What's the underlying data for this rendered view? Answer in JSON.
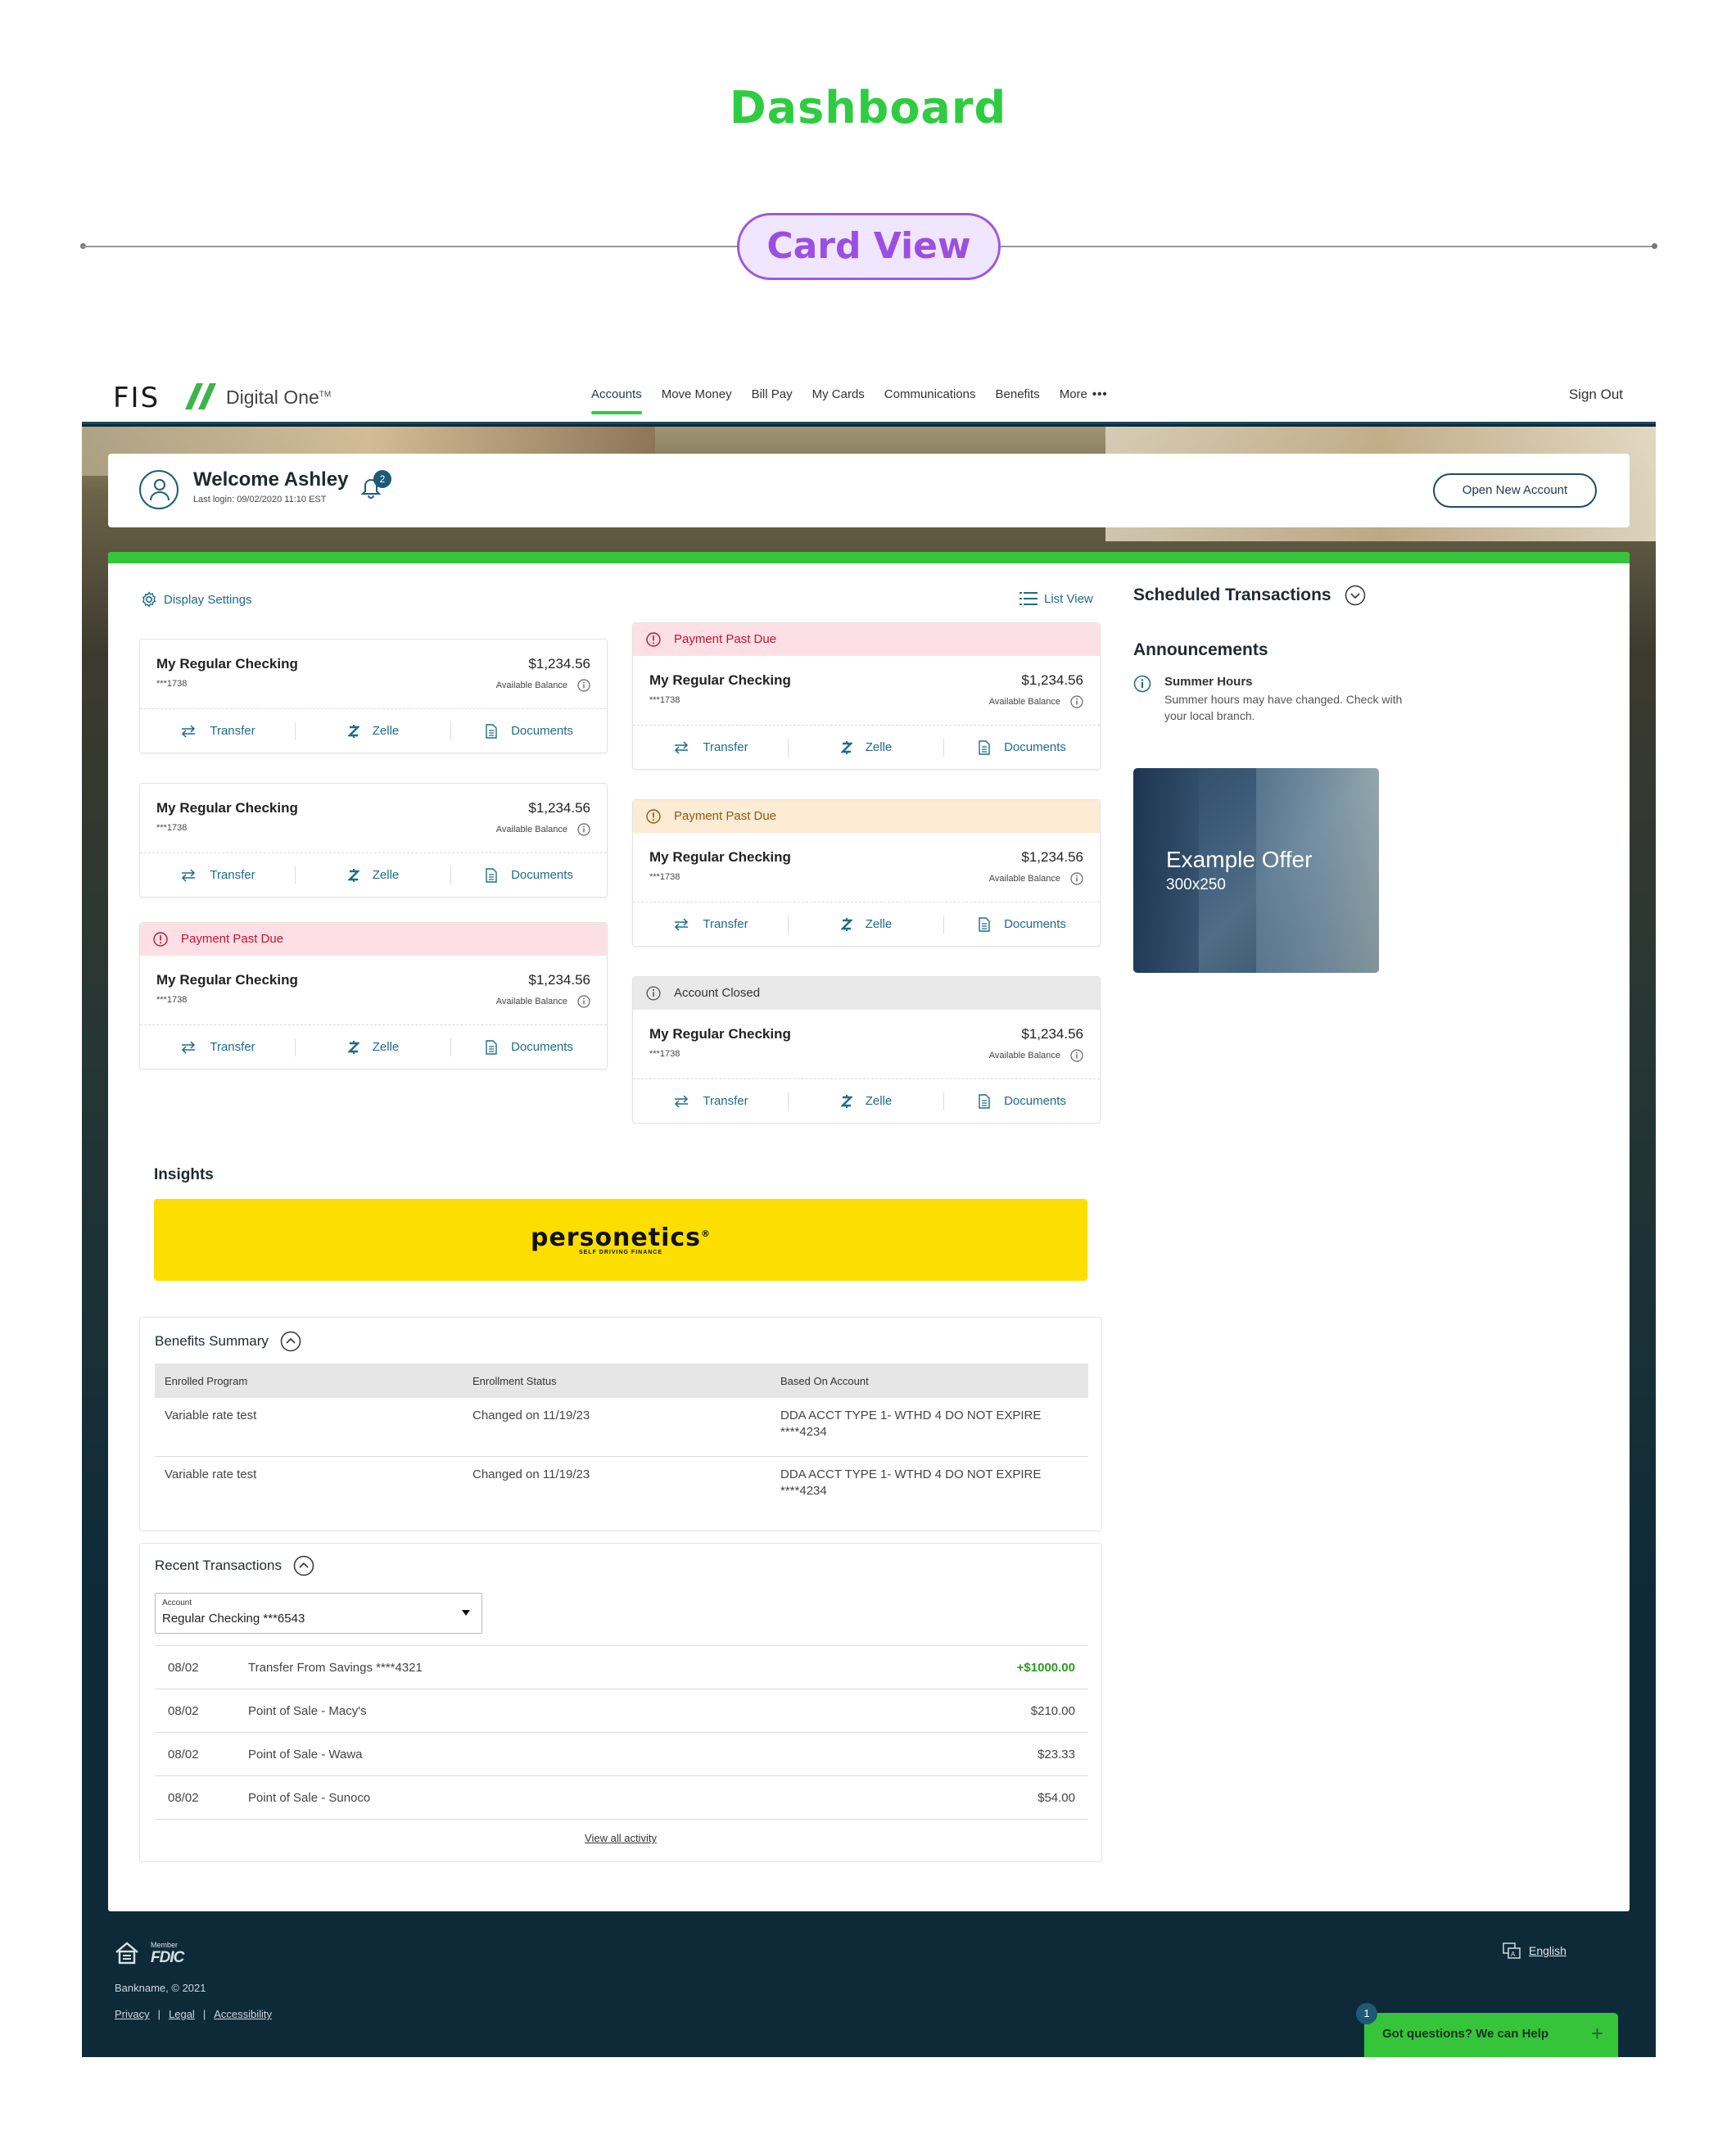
{
  "page": {
    "title": "Dashboard",
    "view_label": "Card View"
  },
  "nav": {
    "logo_fis": "FIS",
    "logo_brand": "Digital One",
    "logo_tm": "TM",
    "items": [
      "Accounts",
      "Move Money",
      "Bill Pay",
      "My Cards",
      "Communications",
      "Benefits",
      "More"
    ],
    "more_dots": "•••",
    "sign_out": "Sign Out"
  },
  "welcome": {
    "greeting": "Welcome Ashley",
    "last_login": "Last login: 09/02/2020  11:10 EST",
    "notifications": "2",
    "open_new_account": "Open New Account"
  },
  "toolbar": {
    "display_settings": "Display Settings",
    "list_view": "List View"
  },
  "card_common": {
    "available_balance": "Available Balance",
    "transfer": "Transfer",
    "zelle": "Zelle",
    "documents": "Documents"
  },
  "cards": [
    {
      "status": "",
      "name": "My Regular Checking",
      "number": "***1738",
      "balance": "$1,234.56"
    },
    {
      "status": "",
      "name": "My Regular Checking",
      "number": "***1738",
      "balance": "$1,234.56"
    },
    {
      "status": "Payment Past Due",
      "name": "My Regular Checking",
      "number": "***1738",
      "balance": "$1,234.56"
    },
    {
      "status": "Payment Past Due",
      "name": "My Regular Checking",
      "number": "***1738",
      "balance": "$1,234.56"
    },
    {
      "status": "Payment Past Due",
      "name": "My Regular Checking",
      "number": "***1738",
      "balance": "$1,234.56"
    },
    {
      "status": "Account Closed",
      "name": "My Regular Checking",
      "number": "***1738",
      "balance": "$1,234.56"
    }
  ],
  "sidebar": {
    "scheduled": "Scheduled Transactions",
    "announcements": "Announcements",
    "announcement_title": "Summer Hours",
    "announcement_text": "Summer hours may have changed. Check with your local branch.",
    "offer_title": "Example Offer",
    "offer_size": "300x250"
  },
  "insights": {
    "heading": "Insights",
    "logo": "personetics",
    "logo_mark": "®",
    "tagline": "SELF DRIVING FINANCE"
  },
  "benefits": {
    "heading": "Benefits Summary",
    "columns": [
      "Enrolled Program",
      "Enrollment Status",
      "Based On Account"
    ],
    "rows": [
      [
        "Variable rate test",
        "Changed on 11/19/23",
        "DDA ACCT TYPE 1- WTHD 4 DO NOT EXPIRE ****4234"
      ],
      [
        "Variable rate test",
        "Changed on 11/19/23",
        "DDA ACCT TYPE 1- WTHD 4 DO NOT EXPIRE ****4234"
      ]
    ]
  },
  "recent": {
    "heading": "Recent Transactions",
    "account_label": "Account",
    "account_value": "Regular Checking ***6543",
    "rows": [
      {
        "date": "08/02",
        "desc": "Transfer From Savings ****4321",
        "amount": "+$1000.00"
      },
      {
        "date": "08/02",
        "desc": "Point of Sale - Macy's",
        "amount": "$210.00"
      },
      {
        "date": "08/02",
        "desc": "Point of Sale - Wawa",
        "amount": "$23.33"
      },
      {
        "date": "08/02",
        "desc": "Point of Sale - Sunoco",
        "amount": "$54.00"
      }
    ],
    "view_all": "View all activity"
  },
  "footer": {
    "fdic_member": "Member",
    "fdic": "FDIC",
    "copyright": "Bankname, © 2021",
    "links": [
      "Privacy",
      "Legal",
      "Accessibility"
    ],
    "separator": "|",
    "language": "English",
    "help": "Got questions? We can Help",
    "help_badge": "1",
    "help_plus": "+"
  },
  "colors": {
    "accent_green": "#36c53a",
    "teal": "#1d6b8a",
    "past_due_red": "#c8102e",
    "dark_bg": "#0e2a39",
    "title_purple": "#9b4fe0"
  }
}
